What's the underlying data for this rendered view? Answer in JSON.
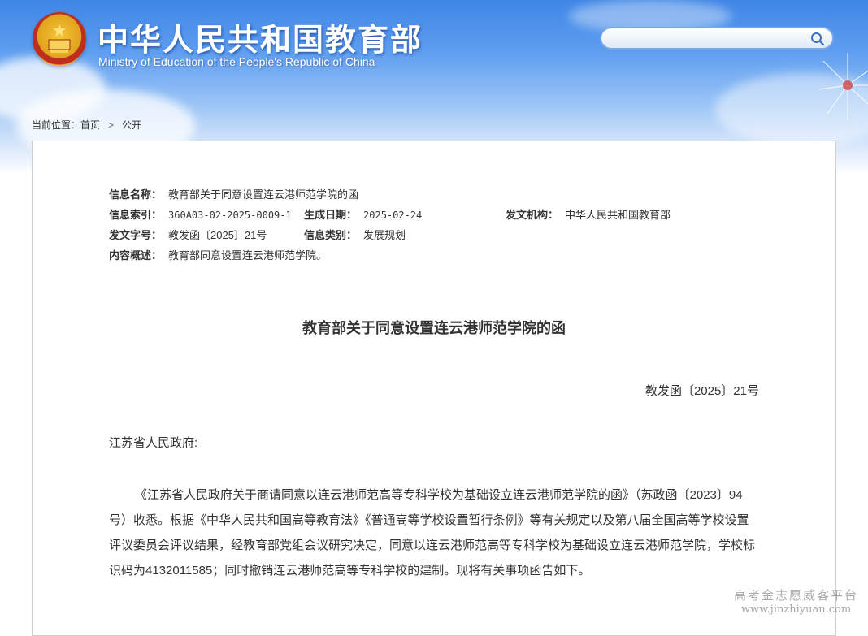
{
  "header": {
    "title": "中华人民共和国教育部",
    "subtitle": "Ministry of Education of the People's Republic of China",
    "search": {
      "value": "",
      "icon": "search-icon"
    },
    "emblem": "national-emblem-icon"
  },
  "breadcrumb": {
    "label": "当前位置：",
    "items": [
      "首页",
      "公开"
    ],
    "separator": ">"
  },
  "meta": {
    "name_key": "信息名称：",
    "name_val": "教育部关于同意设置连云港师范学院的函",
    "index_key": "信息索引：",
    "index_val": "360A03-02-2025-0009-1",
    "date_key": "生成日期：",
    "date_val": "2025-02-24",
    "issuer_key": "发文机构：",
    "issuer_val": "中华人民共和国教育部",
    "docno_key": "发文字号：",
    "docno_val": "教发函〔2025〕21号",
    "category_key": "信息类别：",
    "category_val": "发展规划",
    "summary_key": "内容概述：",
    "summary_val": "教育部同意设置连云港师范学院。"
  },
  "document": {
    "title": "教育部关于同意设置连云港师范学院的函",
    "number": "教发函〔2025〕21号",
    "addressee": "江苏省人民政府:",
    "body": "《江苏省人民政府关于商请同意以连云港师范高等专科学校为基础设立连云港师范学院的函》（苏政函〔2023〕94号）收悉。根据《中华人民共和国高等教育法》《普通高等学校设置暂行条例》等有关规定以及第八届全国高等学校设置评议委员会评议结果，经教育部党组会议研究决定，同意以连云港师范高等专科学校为基础设立连云港师范学院，学校标识码为4132011585；同时撤销连云港师范高等专科学校的建制。现将有关事项函告如下。"
  },
  "watermark": {
    "line1": "高考金志愿威客平台",
    "line2": "www.jinzhiyuan.com"
  },
  "colors": {
    "header_blue": "#3f86e6",
    "text": "#333333",
    "border": "#cfcfcf"
  }
}
